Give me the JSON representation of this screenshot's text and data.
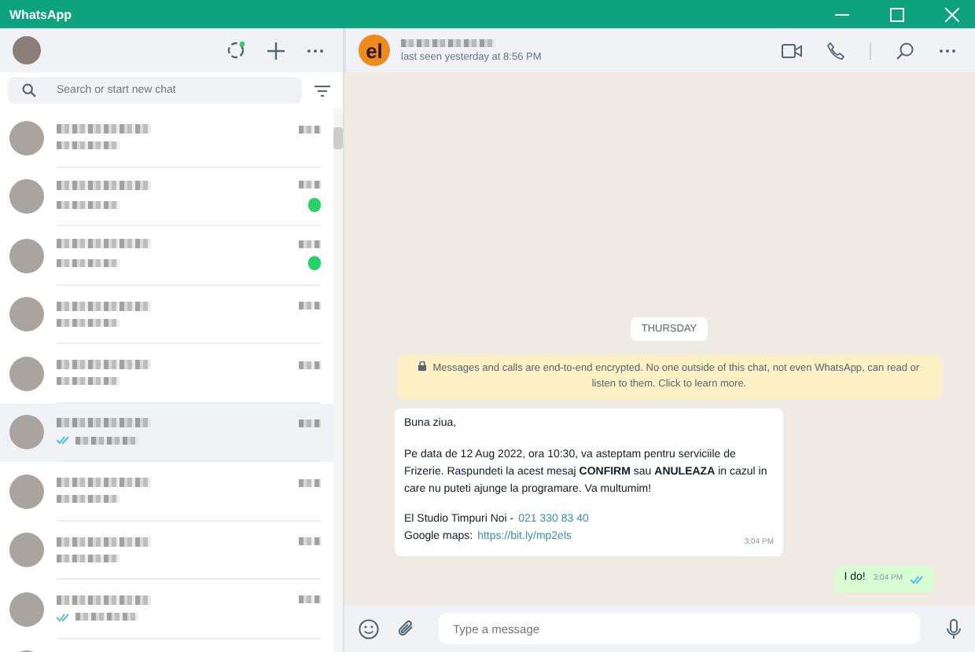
{
  "window": {
    "title": "WhatsApp"
  },
  "search": {
    "placeholder": "Search or start new chat"
  },
  "chats": [
    {
      "selected": false,
      "unread": false,
      "tick": false
    },
    {
      "selected": false,
      "unread": true,
      "tick": false
    },
    {
      "selected": false,
      "unread": true,
      "tick": false
    },
    {
      "selected": false,
      "unread": false,
      "tick": false
    },
    {
      "selected": false,
      "unread": false,
      "tick": false
    },
    {
      "selected": true,
      "unread": false,
      "tick": true
    },
    {
      "selected": false,
      "unread": false,
      "tick": false
    },
    {
      "selected": false,
      "unread": false,
      "tick": false
    },
    {
      "selected": false,
      "unread": false,
      "tick": true
    },
    {
      "selected": false,
      "unread": false,
      "tick": false
    }
  ],
  "conversation": {
    "avatar_text": "el",
    "status": "last seen yesterday at 8:56 PM",
    "day": "THURSDAY",
    "notice": "Messages and calls are end-to-end encrypted. No one outside of this chat, not even WhatsApp, can read or listen to them. Click to learn more.",
    "messages": [
      {
        "kind": "incoming",
        "paragraphs": [
          "Buna ziua,",
          "Pe data de 12 Aug 2022, ora 10:30, va asteptam pentru serviciile de Frizerie. Raspundeti la acest mesaj **CONFIRM** sau **ANULEAZA** in cazul in care nu puteti ajunge la programare. Va multumim!"
        ],
        "links": [
          {
            "label": "El Studio Timpuri Noi -",
            "link": "021 330 83 40"
          },
          {
            "label": "Google maps:",
            "link": "https://bit.ly/mp2els"
          }
        ],
        "time": "3:04 PM"
      },
      {
        "kind": "outgoing",
        "text": "I do!",
        "time": "3:04 PM",
        "read": true
      }
    ],
    "composer": {
      "placeholder": "Type a message"
    }
  }
}
